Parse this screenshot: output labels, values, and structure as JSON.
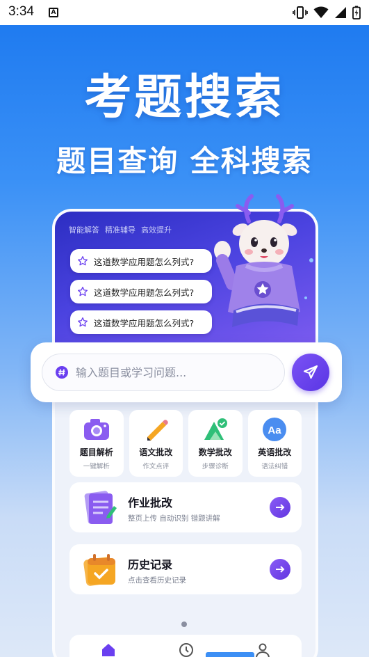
{
  "status_bar": {
    "time": "3:34",
    "notification_icon": "a-notification-icon",
    "icons": [
      "vibrate-icon",
      "wifi-icon",
      "signal-icon",
      "battery-charging-icon"
    ]
  },
  "hero": {
    "title": "考题搜索",
    "subtitle": "题目查询 全科搜索"
  },
  "app": {
    "tagline": [
      "智能解答",
      "精准辅导",
      "高效提升"
    ],
    "questions": [
      {
        "icon": "star-icon",
        "text": "这道数学应用题怎么列式?"
      },
      {
        "icon": "star-icon",
        "text": "这道数学应用题怎么列式?"
      },
      {
        "icon": "star-icon",
        "text": "这道数学应用题怎么列式?"
      }
    ],
    "search": {
      "placeholder": "输入题目或学习问题...",
      "value": "",
      "send_icon": "send-icon"
    },
    "features": [
      {
        "name": "题目解析",
        "desc": "一键解析",
        "icon": "camera-icon"
      },
      {
        "name": "语文批改",
        "desc": "作文点评",
        "icon": "pencil-icon"
      },
      {
        "name": "数学批改",
        "desc": "步骤诊断",
        "icon": "math-check-icon"
      },
      {
        "name": "英语批改",
        "desc": "语法纠错",
        "icon": "aa-letters-icon"
      }
    ],
    "cards": [
      {
        "title": "作业批改",
        "desc": "整页上传 自动识别 错题讲解",
        "icon": "homework-icon",
        "arrow_icon": "arrow-right-icon"
      },
      {
        "title": "历史记录",
        "desc": "点击查看历史记录",
        "icon": "calendar-check-icon",
        "arrow_icon": "arrow-right-icon"
      }
    ],
    "page_indicator": {
      "current": 1,
      "total": 1
    },
    "bottom_nav": [
      "home-icon",
      "clock-icon",
      "profile-icon"
    ]
  },
  "colors": {
    "background_top": "#1f7bf0",
    "accent_purple": "#6a3ff0",
    "header_indigo": "#3a36d0"
  }
}
